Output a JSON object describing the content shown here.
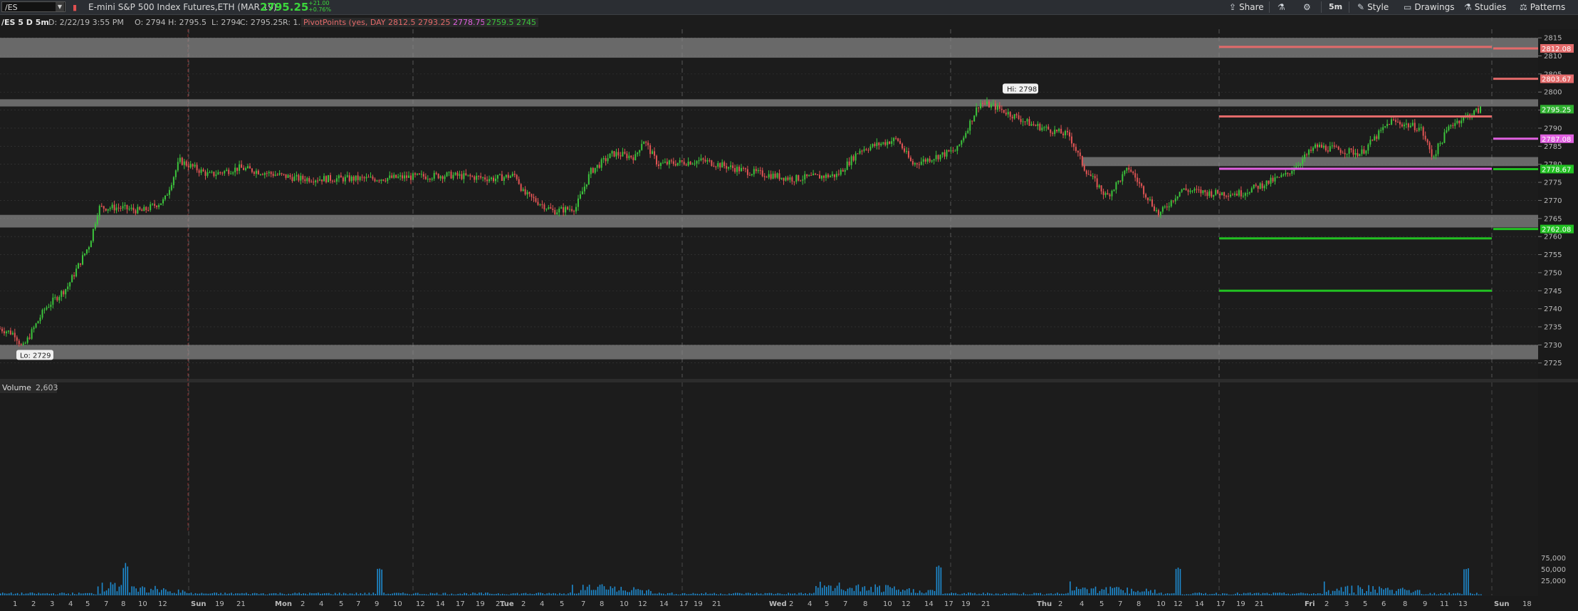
{
  "toolbar": {
    "symbol": "/ES",
    "title": "E-mini S&P 500 Index Futures,ETH (MAR 19)",
    "last_price": "2795.25",
    "change": "+21.00",
    "change_pct": "+0.76%",
    "buttons": {
      "share": "Share",
      "interval": "5m",
      "style": "Style",
      "drawings": "Drawings",
      "studies": "Studies",
      "patterns": "Patterns"
    }
  },
  "info": {
    "symbol_label": "/ES 5 D 5m",
    "date": "D: 2/22/19 3:55 PM",
    "open": "O: 2794",
    "high": "H: 2795.5",
    "low": "L: 2794",
    "close": "C: 2795.25",
    "range": "R: 1.5",
    "pivot_label": "PivotPoints (yes, DAY)",
    "pivots": [
      "2812.5",
      "2793.25",
      "2778.75",
      "2759.5",
      "2745"
    ]
  },
  "volume_panel": {
    "label": "Volume",
    "value": "2,603",
    "ticks": [
      "75,000",
      "50,000",
      "25,000"
    ]
  },
  "colors": {
    "background": "#1c1c1c",
    "grid": "#3a3a3a",
    "up": "#3cc43c",
    "down": "#e05454",
    "pivot_r": "#e36a6a",
    "pivot_p": "#e060e0",
    "pivot_s": "#22c022",
    "zone": "#8a8a8a",
    "volume": "#1e8bd0"
  },
  "chart_data": {
    "type": "candlestick",
    "title": "/ES 5 D 5m",
    "ylim": [
      2721,
      2817
    ],
    "yticks": [
      2815,
      2810,
      2805,
      2800,
      2795,
      2790,
      2785,
      2780,
      2775,
      2770,
      2765,
      2760,
      2755,
      2750,
      2745,
      2740,
      2735,
      2730,
      2725
    ],
    "x_tick_labels": [
      "1",
      "2",
      "3",
      "4",
      "5",
      "7",
      "8",
      "10",
      "12",
      "Sun",
      "19",
      "21",
      "Mon",
      "2",
      "4",
      "5",
      "7",
      "9",
      "10",
      "12",
      "14",
      "17",
      "19",
      "21",
      "Tue",
      "2",
      "4",
      "5",
      "7",
      "8",
      "10",
      "12",
      "14",
      "17",
      "19",
      "21",
      "Wed",
      "2",
      "4",
      "5",
      "7",
      "8",
      "10",
      "12",
      "14",
      "17",
      "19",
      "21",
      "Thu",
      "2",
      "4",
      "5",
      "7",
      "8",
      "10",
      "12",
      "14",
      "17",
      "19",
      "21",
      "Fri",
      "2",
      "3",
      "5",
      "6",
      "8",
      "9",
      "11",
      "13",
      "Sun",
      "18"
    ],
    "session_starts": [
      "Sun",
      "Mon",
      "Tue",
      "Wed",
      "Thu",
      "Fri",
      "Sun"
    ],
    "price_path": [
      [
        0,
        2734.5
      ],
      [
        0.01,
        2733
      ],
      [
        0.015,
        2729
      ],
      [
        0.03,
        2740
      ],
      [
        0.045,
        2746
      ],
      [
        0.06,
        2758
      ],
      [
        0.066,
        2768
      ],
      [
        0.08,
        2768
      ],
      [
        0.095,
        2767
      ],
      [
        0.11,
        2770
      ],
      [
        0.12,
        2781
      ],
      [
        0.14,
        2777
      ],
      [
        0.16,
        2779
      ],
      [
        0.2,
        2776
      ],
      [
        0.25,
        2776
      ],
      [
        0.3,
        2777
      ],
      [
        0.33,
        2776
      ],
      [
        0.345,
        2777
      ],
      [
        0.35,
        2772
      ],
      [
        0.37,
        2767
      ],
      [
        0.385,
        2768
      ],
      [
        0.395,
        2778
      ],
      [
        0.41,
        2783
      ],
      [
        0.425,
        2782
      ],
      [
        0.43,
        2787
      ],
      [
        0.44,
        2780
      ],
      [
        0.47,
        2781
      ],
      [
        0.5,
        2778
      ],
      [
        0.53,
        2776
      ],
      [
        0.56,
        2777
      ],
      [
        0.575,
        2784
      ],
      [
        0.6,
        2787
      ],
      [
        0.61,
        2780
      ],
      [
        0.64,
        2784
      ],
      [
        0.655,
        2797
      ],
      [
        0.665,
        2796
      ],
      [
        0.69,
        2791
      ],
      [
        0.715,
        2788
      ],
      [
        0.725,
        2779
      ],
      [
        0.74,
        2771
      ],
      [
        0.755,
        2779
      ],
      [
        0.775,
        2766
      ],
      [
        0.79,
        2773
      ],
      [
        0.81,
        2772
      ],
      [
        0.83,
        2772
      ],
      [
        0.86,
        2777
      ],
      [
        0.88,
        2785
      ],
      [
        0.91,
        2783
      ],
      [
        0.93,
        2792
      ],
      [
        0.95,
        2790
      ],
      [
        0.958,
        2782
      ],
      [
        0.97,
        2791
      ],
      [
        0.99,
        2795.25
      ]
    ],
    "high": 2798,
    "high_label": "Hi: 2798",
    "low": 2729,
    "low_label": "Lo: 2729",
    "support_resistance_zones": [
      [
        2809.5,
        2815
      ],
      [
        2796,
        2798
      ],
      [
        2779.5,
        2782
      ],
      [
        2762.5,
        2766
      ],
      [
        2726,
        2730
      ]
    ],
    "pivot_levels_friday": [
      {
        "value": 2812.5,
        "kind": "R2"
      },
      {
        "value": 2793.25,
        "kind": "R1"
      },
      {
        "value": 2778.75,
        "kind": "P"
      },
      {
        "value": 2759.5,
        "kind": "S1"
      },
      {
        "value": 2745,
        "kind": "S2"
      }
    ],
    "pivot_levels_next": [
      {
        "value": 2812.08,
        "label": "2812.08",
        "kind": "R2"
      },
      {
        "value": 2803.67,
        "label": "2803.67",
        "kind": "R1"
      },
      {
        "value": 2787.08,
        "label": "2787.08",
        "kind": "P"
      },
      {
        "value": 2778.67,
        "label": "2778.67",
        "kind": "S1"
      },
      {
        "value": 2762.08,
        "label": "2762.08",
        "kind": "S2"
      }
    ],
    "last_price_label": "2795.25"
  }
}
